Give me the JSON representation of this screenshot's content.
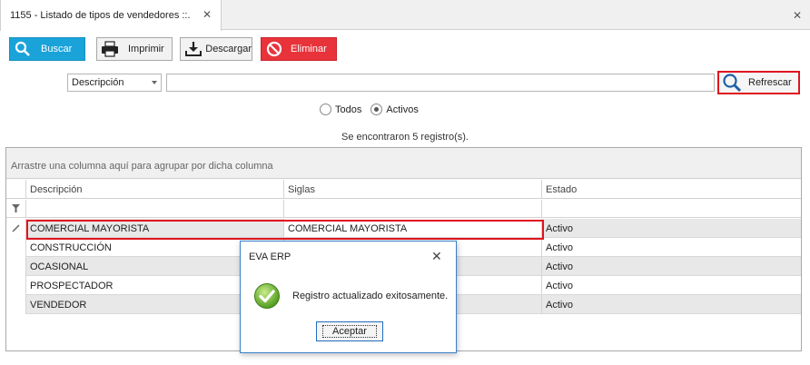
{
  "tab": {
    "title": "1155 - Listado de tipos de vendedores ::."
  },
  "toolbar": {
    "buscar_label": "Buscar",
    "imprimir_label": "Imprimir",
    "descargar_label": "Descargar",
    "eliminar_label": "Eliminar",
    "buscar_color": "#1aa3d9",
    "eliminar_color": "#e8333a"
  },
  "filter": {
    "field_selected": "Descripción",
    "search_value": "",
    "refrescar_label": "Refrescar"
  },
  "radios": {
    "todos_label": "Todos",
    "activos_label": "Activos",
    "selected": "Activos"
  },
  "status": {
    "count_text": "Se encontraron 5 registro(s)."
  },
  "grid": {
    "group_hint": "Arrastre una columna aquí para agrupar por dicha columna",
    "columns": [
      "Descripción",
      "Siglas",
      "Estado"
    ],
    "rows": [
      {
        "descripcion": "COMERCIAL MAYORISTA",
        "siglas": "COMERCIAL MAYORISTA",
        "estado": "Activo"
      },
      {
        "descripcion": "CONSTRUCCIÓN",
        "siglas": "",
        "estado": "Activo"
      },
      {
        "descripcion": "OCASIONAL",
        "siglas": "",
        "estado": "Activo"
      },
      {
        "descripcion": "PROSPECTADOR",
        "siglas": "",
        "estado": "Activo"
      },
      {
        "descripcion": "VENDEDOR",
        "siglas": "",
        "estado": "Activo"
      }
    ]
  },
  "dialog": {
    "title": "EVA ERP",
    "message": "Registro actualizado exitosamente.",
    "button_label": "Aceptar"
  },
  "highlight_color": "#e0141e"
}
